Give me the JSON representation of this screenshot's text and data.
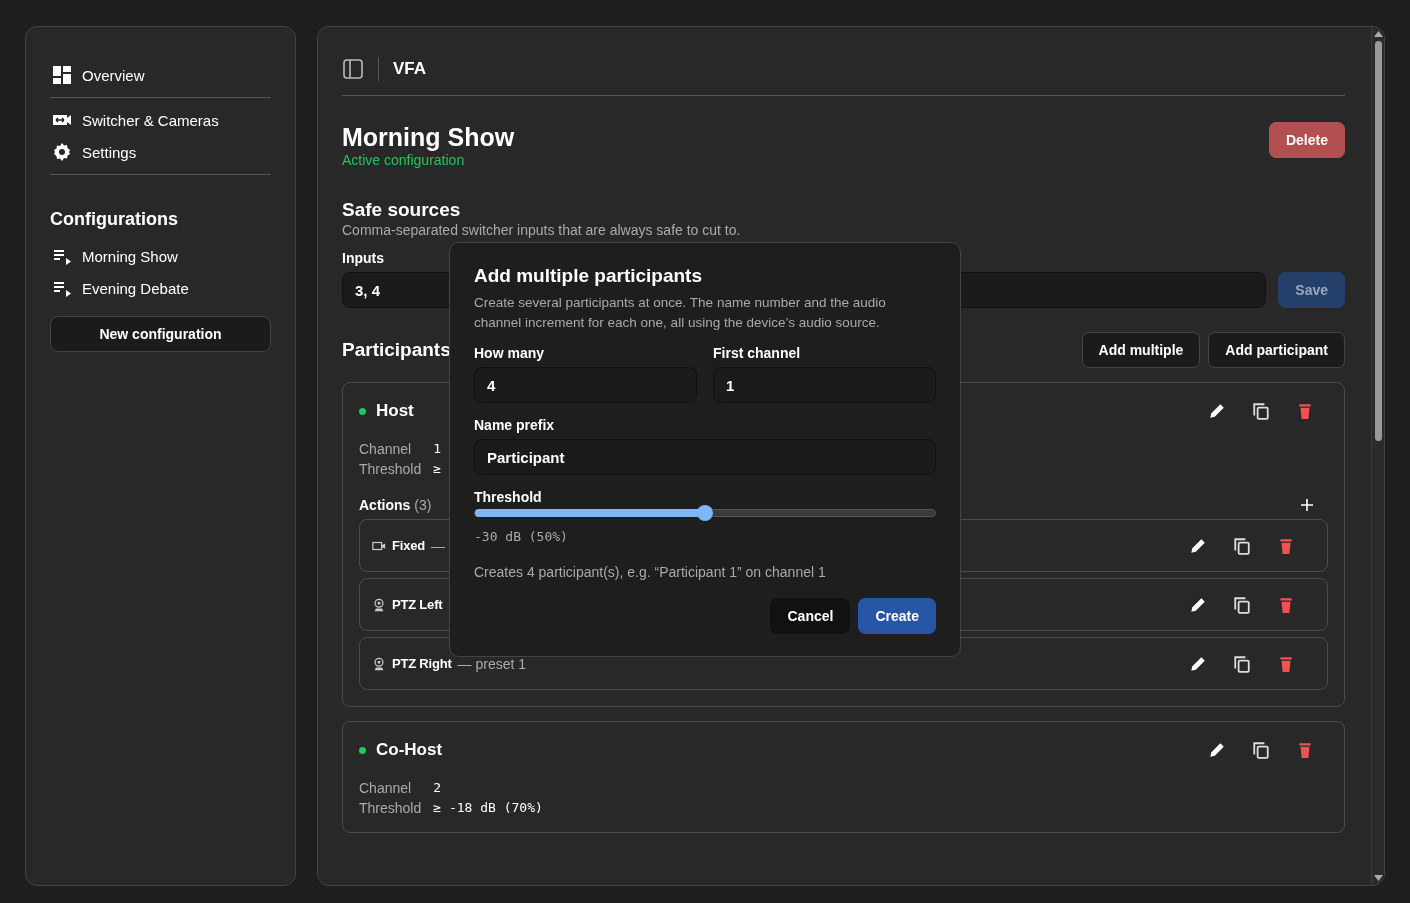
{
  "sidebar": {
    "nav": [
      {
        "kind": "overview",
        "label": "Overview"
      },
      {
        "kind": "divider"
      },
      {
        "kind": "switcher",
        "label": "Switcher & Cameras"
      },
      {
        "kind": "settings",
        "label": "Settings"
      },
      {
        "kind": "divider"
      }
    ],
    "configurations_heading": "Configurations",
    "configurations": [
      "Morning Show",
      "Evening Debate"
    ],
    "new_button": "New configuration"
  },
  "header": {
    "title": "VFA"
  },
  "page": {
    "title": "Morning Show",
    "status": "Active configuration",
    "delete_button": "Delete"
  },
  "safe_sources": {
    "heading": "Safe sources",
    "description": "Comma-separated switcher inputs that are always safe to cut to.",
    "label": "Inputs",
    "value": "3, 4",
    "save_button": "Save"
  },
  "participants": {
    "heading": "Participants",
    "buttons": [
      "Add multiple",
      "Add participant"
    ],
    "items": [
      {
        "name": "Host",
        "color": "#22c55e",
        "channel_label": "Channel",
        "channel": "1",
        "threshold_label": "Threshold",
        "threshold": "≥",
        "actions_label": "Actions",
        "actions_count": "(3)",
        "actions": [
          {
            "kind": "camera",
            "name": "Fixed",
            "detail": "—"
          },
          {
            "kind": "ptz",
            "name": "PTZ Left"
          },
          {
            "kind": "ptz",
            "name": "PTZ Right",
            "detail": "— preset 1"
          }
        ]
      },
      {
        "name": "Co-Host",
        "color": "#22c55e",
        "channel_label": "Channel",
        "channel": "2",
        "threshold_label": "Threshold",
        "threshold": "≥ -18 dB (70%)"
      }
    ]
  },
  "dialog": {
    "title": "Add multiple participants",
    "description": "Create several participants at once. The name number and the audio channel increment for each one, all using the device’s audio source.",
    "how_many_label": "How many",
    "how_many": "4",
    "first_channel_label": "First channel",
    "first_channel": "1",
    "prefix_label": "Name prefix",
    "prefix": "Participant",
    "threshold_label": "Threshold",
    "threshold": {
      "level": 0.5
    },
    "threshold_reading": "-30 dB (50%)",
    "summary": "Creates 4 participant(s), e.g. “Participant 1” on channel 1",
    "cancel_button": "Cancel",
    "create_button": "Create"
  }
}
